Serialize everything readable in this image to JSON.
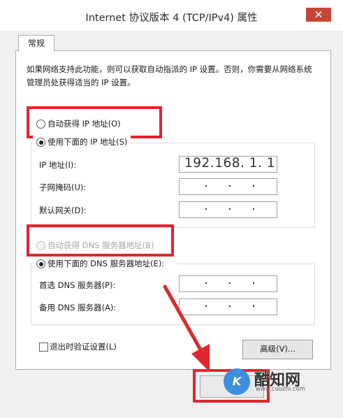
{
  "window": {
    "title": "Internet 协议版本 4 (TCP/IPv4) 属性",
    "close_glyph": "✕"
  },
  "tabs": [
    {
      "label": "常规"
    }
  ],
  "description": "如果网络支持此功能，则可以获取自动指派的 IP 设置。否则，你需要从网络系统管理员处获得适当的 IP 设置。",
  "ip": {
    "auto_label": "自动获得 IP 地址(O)",
    "manual_label": "使用下面的 IP 地址(S)",
    "selected": "manual",
    "fields": [
      {
        "label": "IP 地址(I):",
        "value": "192.168.  1.  1"
      },
      {
        "label": "子网掩码(U):",
        "value": ""
      },
      {
        "label": "默认网关(D):",
        "value": ""
      }
    ]
  },
  "dns": {
    "auto_label": "自动获得 DNS 服务器地址(B)",
    "manual_label": "使用下面的 DNS 服务器地址(E):",
    "selected": "manual",
    "auto_disabled": true,
    "fields": [
      {
        "label": "首选 DNS 服务器(P):",
        "value": ""
      },
      {
        "label": "备用 DNS 服务器(A):",
        "value": ""
      }
    ]
  },
  "validate": {
    "label": "退出时验证设置(L)",
    "checked": false
  },
  "advanced_button": "高级(V)...",
  "watermark": {
    "logo": "K",
    "name": "酷知网",
    "url": "www.coozhi.com"
  },
  "annotation_color": "#e0262f"
}
